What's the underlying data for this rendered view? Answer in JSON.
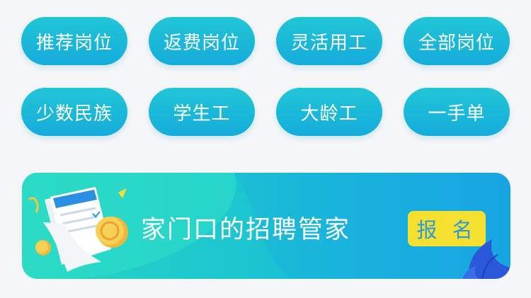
{
  "categories": [
    {
      "label": "推荐岗位"
    },
    {
      "label": "返费岗位"
    },
    {
      "label": "灵活用工"
    },
    {
      "label": "全部岗位"
    },
    {
      "label": "少数民族"
    },
    {
      "label": "学生工"
    },
    {
      "label": "大龄工"
    },
    {
      "label": "一手单"
    }
  ],
  "banner": {
    "title": "家门口的招聘管家",
    "button_label": "报 名",
    "colors": {
      "start": "#27d6c4",
      "end": "#16a6e1",
      "button": "#f5e030",
      "button_text": "#2b9bd8"
    }
  },
  "icons": [
    "document-coin-illustration",
    "leaf-decoration-icon"
  ]
}
